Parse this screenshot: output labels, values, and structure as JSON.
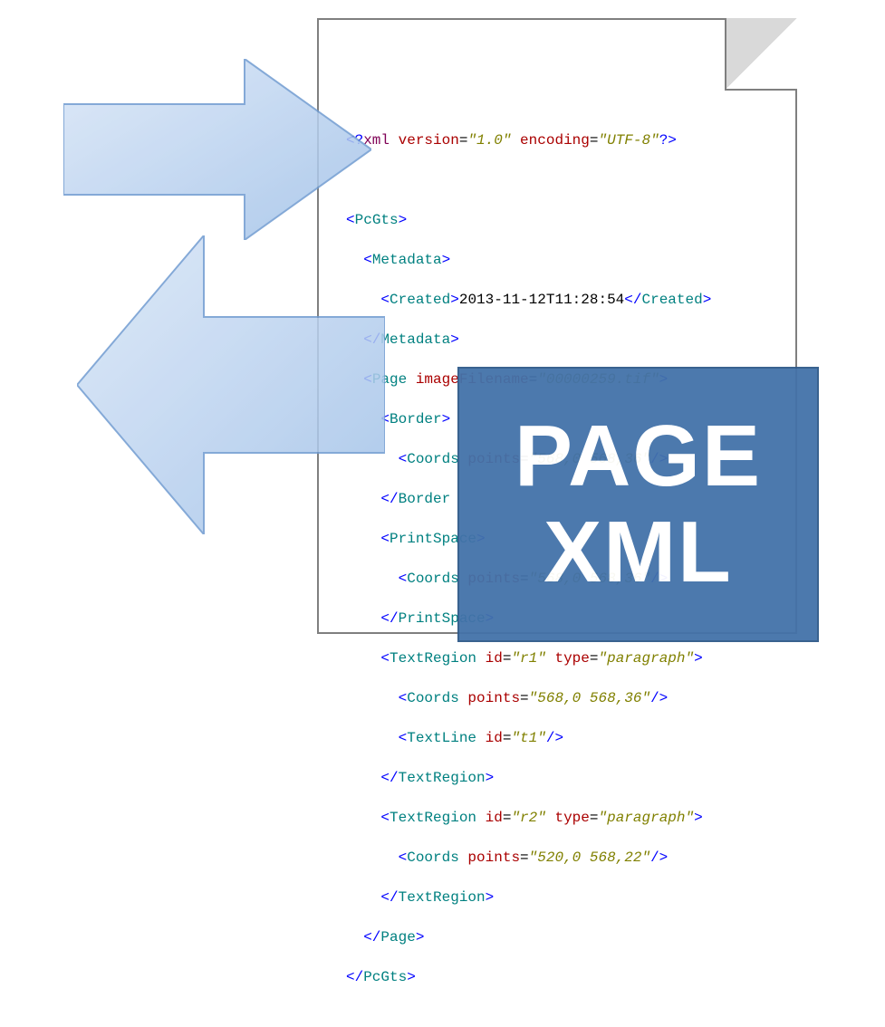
{
  "badge": {
    "line1": "PAGE",
    "line2": "XML"
  },
  "code": {
    "l01": {
      "a": "<?",
      "b": "xml",
      "c": " version",
      "d": "=",
      "e": "\"1.0\"",
      "f": " encoding",
      "g": "=",
      "h": "\"UTF-8\"",
      "i": "?>"
    },
    "l02": {
      "a": "<",
      "b": "PcGts",
      "c": ">"
    },
    "l03": {
      "a": "  <",
      "b": "Metadata",
      "c": ">"
    },
    "l04": {
      "a": "    <",
      "b": "Created",
      "c": ">",
      "d": "2013-11-12T11:28:54",
      "e": "</",
      "f": "Created",
      "g": ">"
    },
    "l05": {
      "a": "  </",
      "b": "Metadata",
      "c": ">"
    },
    "l06": {
      "a": "  <",
      "b": "Page",
      "c": " imageFilename",
      "d": "=",
      "e": "\"00000259.tif\"",
      "f": ">"
    },
    "l07": {
      "a": "    <",
      "b": "Border",
      "c": ">"
    },
    "l08": {
      "a": "      <",
      "b": "Coords",
      "c": " points",
      "d": "=",
      "e": "\"568,0 568,36\"",
      "f": "/>"
    },
    "l09": {
      "a": "    </",
      "b": "Border"
    },
    "l10": {
      "a": "    <",
      "b": "PrintSpace",
      "c": ">"
    },
    "l11": {
      "a": "      <",
      "b": "Coords",
      "c": " points",
      "d": "=",
      "e": "\"568,0 568,36\"",
      "f": "/>"
    },
    "l12": {
      "a": "    </",
      "b": "PrintSpace",
      "c": ">"
    },
    "l13": {
      "a": "    <",
      "b": "TextRegion",
      "c": " id",
      "d": "=",
      "e": "\"r1\"",
      "f": " type",
      "g": "=",
      "h": "\"paragraph\"",
      "i": ">"
    },
    "l14": {
      "a": "      <",
      "b": "Coords",
      "c": " points",
      "d": "=",
      "e": "\"568,0 568,36\"",
      "f": "/>"
    },
    "l15": {
      "a": "      <",
      "b": "TextLine",
      "c": " id",
      "d": "=",
      "e": "\"t1\"",
      "f": "/>"
    },
    "l16": {
      "a": "    </",
      "b": "TextRegion",
      "c": ">"
    },
    "l17": {
      "a": "    <",
      "b": "TextRegion",
      "c": " id",
      "d": "=",
      "e": "\"r2\"",
      "f": " type",
      "g": "=",
      "h": "\"paragraph\"",
      "i": ">"
    },
    "l18": {
      "a": "      <",
      "b": "Coords",
      "c": " points",
      "d": "=",
      "e": "\"520,0 568,22\"",
      "f": "/>"
    },
    "l19": {
      "a": "    </",
      "b": "TextRegion",
      "c": ">"
    },
    "l20": {
      "a": "  </",
      "b": "Page",
      "c": ">"
    },
    "l21": {
      "a": "</",
      "b": "PcGts",
      "c": ">"
    }
  }
}
